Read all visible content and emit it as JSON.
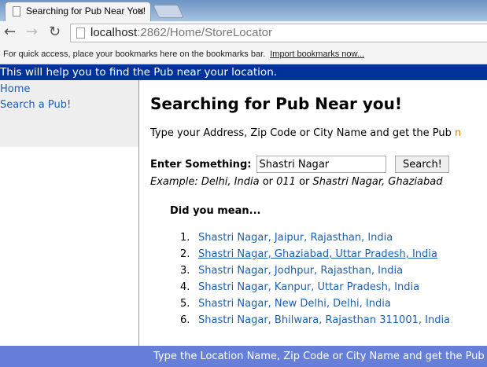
{
  "browser": {
    "tab_title": "Searching for Pub Near You!",
    "url_host": "localhost",
    "url_path": ":2862/Home/StoreLocator",
    "bookmarks_msg": "For quick access, place your bookmarks here on the bookmarks bar.",
    "import_link": "Import bookmarks now..."
  },
  "banner": "This will help you to find the Pub near your location.",
  "sidebar": {
    "items": [
      {
        "label": "Home"
      },
      {
        "label": "Search a Pub!"
      }
    ]
  },
  "main": {
    "title": "Searching for Pub Near you!",
    "intro": "Type your Address, Zip Code or City Name and get the Pub",
    "intro_cut": "n",
    "label": "Enter Something:",
    "input_value": "Shastri Nagar",
    "search_button": "Search!",
    "example": {
      "prefix": "Example: ",
      "a": "Delhi, India",
      "or1": " or ",
      "b": "011",
      "or2": " or ",
      "c": "Shastri Nagar, Ghaziabad"
    },
    "did_you_mean": "Did you mean...",
    "suggestions": [
      "Shastri Nagar, Jaipur, Rajasthan, India",
      "Shastri Nagar, Ghaziabad, Uttar Pradesh, India",
      "Shastri Nagar, Jodhpur, Rajasthan, India",
      "Shastri Nagar, Kanpur, Uttar Pradesh, India",
      "Shastri Nagar, New Delhi, Delhi, India",
      "Shastri Nagar, Bhilwara, Rajasthan 311001, India"
    ]
  },
  "footer": "Type the Location Name, Zip Code or City Name and get the Pub near your location."
}
